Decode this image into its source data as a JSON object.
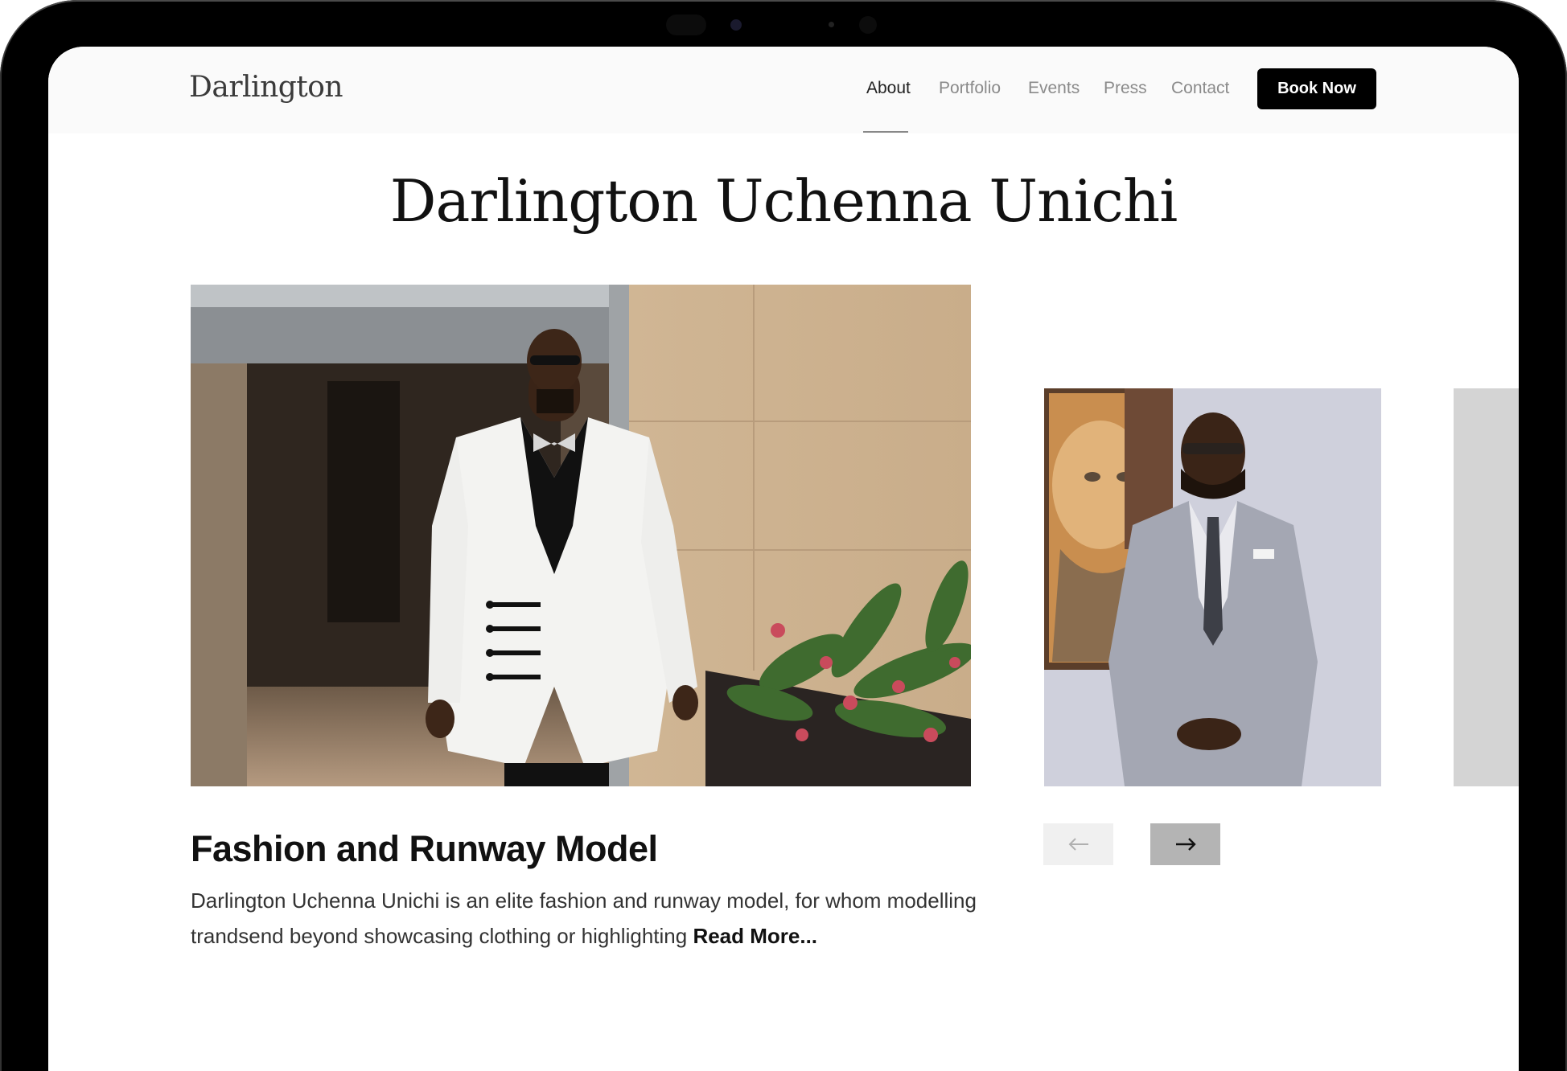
{
  "brand": {
    "logo": "Darlington"
  },
  "nav": {
    "items": [
      {
        "label": "About",
        "active": true
      },
      {
        "label": "Portfolio",
        "active": false
      },
      {
        "label": "Events",
        "active": false
      },
      {
        "label": "Press",
        "active": false
      },
      {
        "label": "Contact",
        "active": false
      }
    ],
    "cta_label": "Book Now"
  },
  "hero": {
    "title": "Darlington Uchenna Unichi"
  },
  "feature": {
    "title": "Fashion and Runway Model",
    "description": "Darlington Uchenna Unichi is an elite fashion and runway model, for whom modelling trandsend beyond showcasing clothing or highlighting",
    "read_more_label": "Read More..."
  },
  "carousel": {
    "prev_icon": "arrow-left-icon",
    "next_icon": "arrow-right-icon"
  },
  "colors": {
    "accent": "#000000",
    "text": "#111111",
    "muted": "#8a8a8a"
  }
}
